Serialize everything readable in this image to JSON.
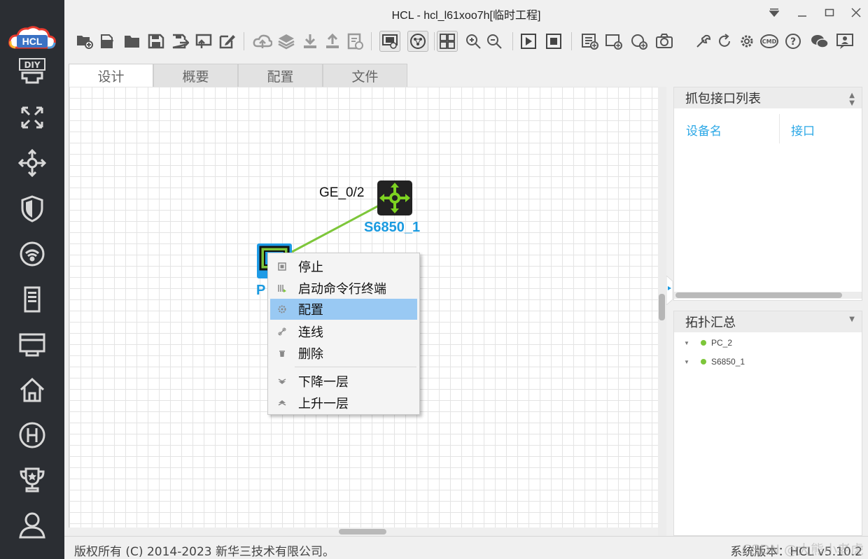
{
  "window": {
    "title": "HCL - hcl_l61xoo7h[临时工程]",
    "controls": [
      "chevron-down-icon",
      "minimize-icon",
      "maximize-icon",
      "close-icon"
    ]
  },
  "sidebar": {
    "logo_text": "HCL",
    "items": [
      {
        "name": "diy-icon",
        "label": "DIY"
      },
      {
        "name": "router-icon"
      },
      {
        "name": "switch-icon"
      },
      {
        "name": "firewall-icon"
      },
      {
        "name": "wireless-icon"
      },
      {
        "name": "server-icon"
      },
      {
        "name": "network-icon"
      },
      {
        "name": "home-icon"
      },
      {
        "name": "h-icon"
      },
      {
        "name": "trophy-icon"
      },
      {
        "name": "user-icon"
      }
    ]
  },
  "toolbar": {
    "buttons": [
      "new-project",
      "open-project",
      "open-folder",
      "save",
      "save-as",
      "export",
      "edit",
      "cloud",
      "layers",
      "download",
      "upload",
      "log",
      "screenshot-view",
      "topology-view",
      "grid-view",
      "zoom-in",
      "zoom-out",
      "start-all",
      "stop-all",
      "console-list",
      "add-device",
      "add-note",
      "capture",
      "tools",
      "refresh",
      "settings",
      "cmd",
      "help",
      "wechat",
      "feedback"
    ]
  },
  "tabs": [
    {
      "label": "设计",
      "active": true
    },
    {
      "label": "概要",
      "active": false
    },
    {
      "label": "配置",
      "active": false
    },
    {
      "label": "文件",
      "active": false
    }
  ],
  "canvas": {
    "switch_label": "S6850_1",
    "port_label": "GE_0/2",
    "pc_label": "PC_2",
    "pc_label_visible": "P",
    "link_color": "#7dc63a",
    "device_label_color": "#1a9ae0"
  },
  "context_menu": {
    "items": [
      {
        "label": "停止",
        "icon": "stop-icon",
        "selected": false
      },
      {
        "label": "启动命令行终端",
        "icon": "terminal-icon",
        "selected": false
      },
      {
        "label": "配置",
        "icon": "gear-icon",
        "selected": true
      },
      {
        "label": "连线",
        "icon": "link-icon",
        "selected": false
      },
      {
        "label": "删除",
        "icon": "trash-icon",
        "selected": false
      },
      {
        "label": "下降一层",
        "icon": "layer-down-icon",
        "selected": false
      },
      {
        "label": "上升一层",
        "icon": "layer-up-icon",
        "selected": false
      }
    ]
  },
  "capture_panel": {
    "title": "抓包接口列表",
    "columns": [
      "设备名",
      "接口"
    ]
  },
  "topology_panel": {
    "title": "拓扑汇总",
    "items": [
      "PC_2",
      "S6850_1"
    ]
  },
  "statusbar": {
    "copyright": "版权所有 (C) 2014-2023 新华三技术有限公司。",
    "version": "系统版本：HCL v5.10.2",
    "watermark": "CSDN @大熊小老虎"
  }
}
